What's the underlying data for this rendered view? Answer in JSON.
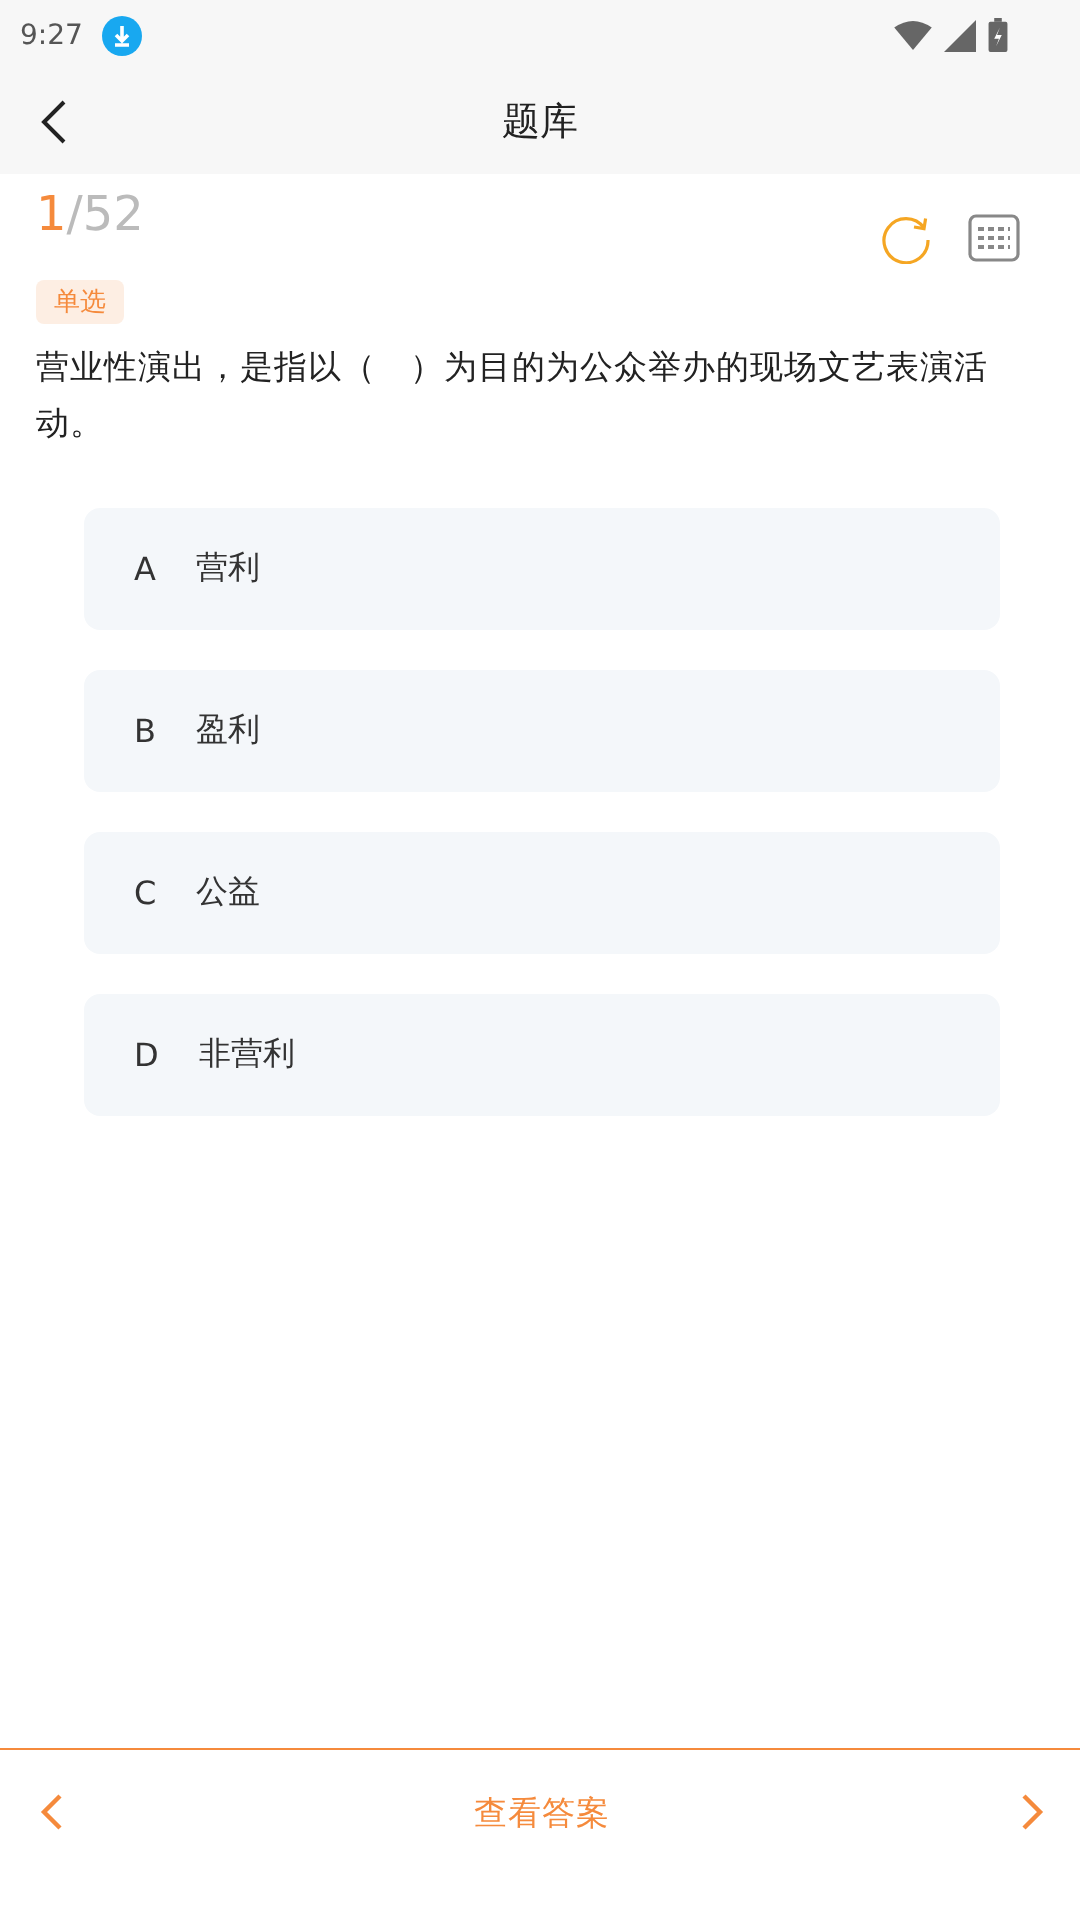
{
  "status_bar": {
    "time": "9:27"
  },
  "header": {
    "title": "题库"
  },
  "progress": {
    "current": "1",
    "total": "/52"
  },
  "question": {
    "type_tag": "单选",
    "text": "营业性演出，是指以（　）为目的为公众举办的现场文艺表演活动。",
    "options": [
      {
        "letter": "A",
        "text": "营利"
      },
      {
        "letter": "B",
        "text": "盈利"
      },
      {
        "letter": "C",
        "text": "公益"
      },
      {
        "letter": "D",
        "text": "非营利"
      }
    ]
  },
  "footer": {
    "action": "查看答案"
  }
}
